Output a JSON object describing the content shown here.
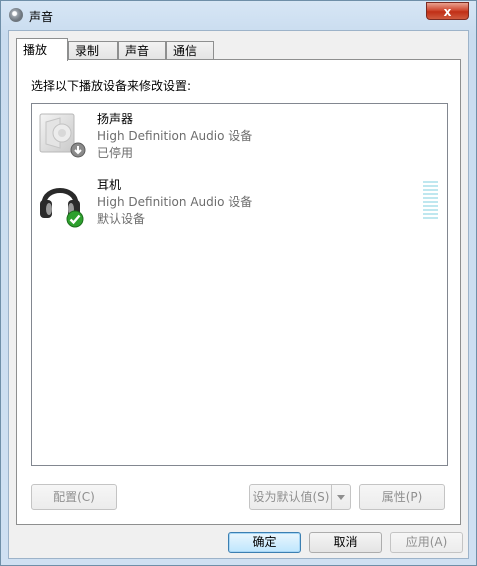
{
  "window": {
    "title": "声音",
    "close_glyph": "x"
  },
  "tabs": [
    {
      "label": "播放",
      "active": true
    },
    {
      "label": "录制",
      "active": false
    },
    {
      "label": "声音",
      "active": false
    },
    {
      "label": "通信",
      "active": false
    }
  ],
  "panel": {
    "instruction": "选择以下播放设备来修改设置:"
  },
  "devices": [
    {
      "name": "扬声器",
      "description": "High Definition Audio 设备",
      "status": "已停用",
      "icon": "speaker-icon",
      "badge": "disabled-arrow-badge"
    },
    {
      "name": "耳机",
      "description": "High Definition Audio 设备",
      "status": "默认设备",
      "icon": "headphones-icon",
      "badge": "default-check-badge"
    }
  ],
  "level_meter": {
    "level": 0
  },
  "panel_buttons": {
    "configure": "配置(C)",
    "set_default": "设为默认值(S)",
    "properties": "属性(P)"
  },
  "dialog_buttons": {
    "ok": "确定",
    "cancel": "取消",
    "apply": "应用(A)"
  },
  "colors": {
    "accent": "#3c7fb1",
    "close_button": "#c02f16",
    "default_check": "#2ea02e"
  }
}
